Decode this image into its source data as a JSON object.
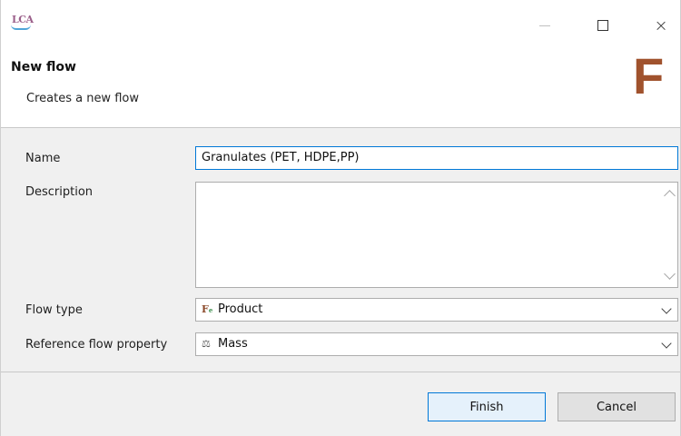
{
  "app": {
    "logo_text": "LCA"
  },
  "window": {
    "close_glyph": "×"
  },
  "dialog": {
    "title": "New flow",
    "subtitle": "Creates a new flow",
    "type_letter": "F"
  },
  "form": {
    "name_label": "Name",
    "name_value": "Granulates (PET, HDPE,PP)",
    "description_label": "Description",
    "description_value": "",
    "flow_type_label": "Flow type",
    "flow_type_value": "Product",
    "flow_type_icon": "product-flow-icon",
    "ref_property_label": "Reference flow property",
    "ref_property_value": "Mass",
    "ref_property_icon": "scale-icon"
  },
  "footer": {
    "finish_label": "Finish",
    "cancel_label": "Cancel"
  },
  "colors": {
    "accent": "#0078d7",
    "type_letter": "#a0522d",
    "panel_bg": "#f0f0f0"
  }
}
